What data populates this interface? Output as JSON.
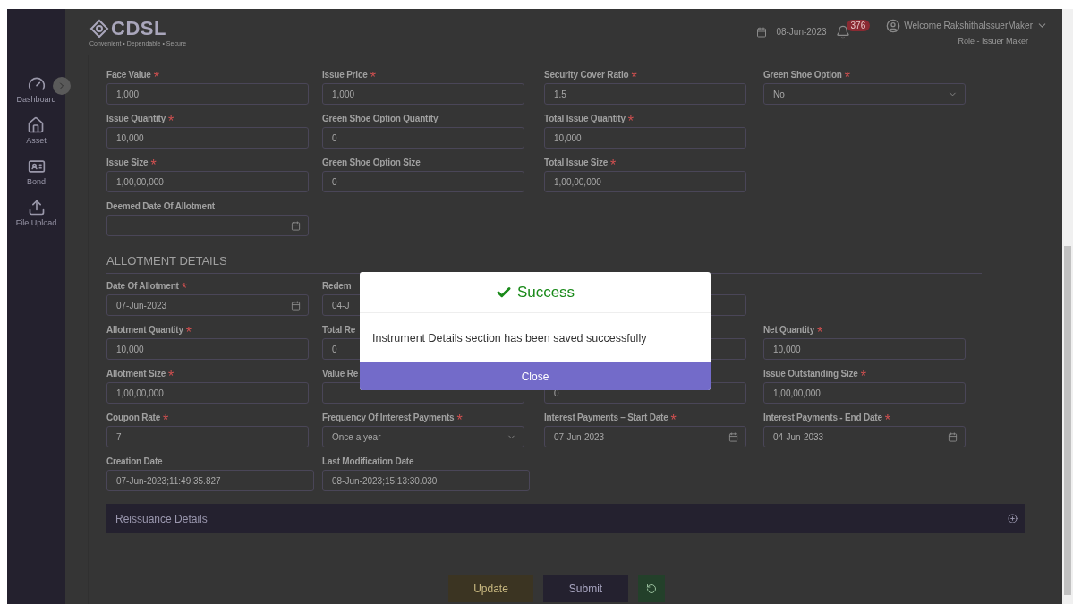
{
  "header": {
    "logo": {
      "name": "CDSL",
      "tagline": "Convenient • Dependable • Secure"
    },
    "date": "08-Jun-2023",
    "notifications": "376",
    "user": {
      "welcome": "Welcome RakshithaIssuerMaker",
      "role": "Role - Issuer Maker"
    }
  },
  "sidebar": {
    "items": [
      {
        "label": "Dashboard"
      },
      {
        "label": "Asset"
      },
      {
        "label": "Bond"
      },
      {
        "label": "File Upload"
      }
    ]
  },
  "issue_fields": [
    {
      "label": "Face Value",
      "marker": "*",
      "value": "1,000",
      "kind": "text"
    },
    {
      "label": "Issue Price",
      "marker": "*",
      "value": "1,000",
      "kind": "text"
    },
    {
      "label": "Security Cover Ratio",
      "marker": "*",
      "value": "1.5",
      "kind": "text"
    },
    {
      "label": "Green Shoe Option",
      "marker": "*",
      "value": "No",
      "kind": "select"
    },
    {
      "label": "Issue Quantity",
      "marker": "*",
      "value": "10,000",
      "kind": "text"
    },
    {
      "label": "Green Shoe Option Quantity",
      "value": "0",
      "kind": "text"
    },
    {
      "label": "Total Issue Quantity",
      "marker": "*",
      "value": "10,000",
      "kind": "text"
    },
    {
      "kind": "empty"
    },
    {
      "label": "Issue Size",
      "marker": "*",
      "value": "1,00,00,000",
      "kind": "text"
    },
    {
      "label": "Green Shoe Option Size",
      "value": "0",
      "kind": "text"
    },
    {
      "label": "Total Issue Size",
      "marker": "*",
      "value": "1,00,00,000",
      "kind": "text"
    },
    {
      "kind": "empty"
    },
    {
      "label": "Deemed Date Of Allotment",
      "kind": "date"
    }
  ],
  "allotment": {
    "title": "ALLOTMENT DETAILS",
    "fields": [
      {
        "label": "Date Of Allotment",
        "marker": "*",
        "value": "07-Jun-2023",
        "kind": "date"
      },
      {
        "label": "Redem",
        "value": "04-J",
        "kind": "text"
      },
      {
        "kind": "text"
      },
      {
        "kind": "empty"
      },
      {
        "label": "Allotment Quantity",
        "marker": "*",
        "value": "10,000",
        "kind": "text"
      },
      {
        "label": "Total Re",
        "value": "0",
        "kind": "text"
      },
      {
        "kind": "text"
      },
      {
        "label": "Net Quantity",
        "marker": "*",
        "value": "10,000",
        "kind": "text"
      },
      {
        "label": "Allotment Size",
        "marker": "*",
        "value": "1,00,00,000",
        "kind": "text"
      },
      {
        "label": "Value Re",
        "kind": "text"
      },
      {
        "value": "0",
        "kind": "text"
      },
      {
        "label": "Issue Outstanding Size",
        "marker": "*",
        "value": "1,00,00,000",
        "kind": "text"
      },
      {
        "label": "Coupon Rate",
        "marker": "*",
        "value": "7",
        "kind": "text"
      },
      {
        "label": "Frequency Of Interest Payments",
        "marker": "*",
        "value": "Once a year",
        "kind": "select"
      },
      {
        "label": "Interest Payments – Start Date",
        "marker": "*",
        "value": "07-Jun-2023",
        "kind": "date"
      },
      {
        "label": "Interest Payments - End Date",
        "marker": "*",
        "value": "04-Jun-2033",
        "kind": "date"
      },
      {
        "label": "Creation Date",
        "value": "07-Jun-2023;11:49:35.827",
        "kind": "text"
      },
      {
        "label": "Last Modification Date",
        "value": "08-Jun-2023;15:13:30.030",
        "kind": "text"
      }
    ]
  },
  "reissuance": {
    "title": "Reissuance Details",
    "expanded": false
  },
  "buttons": [
    {
      "label": "Update",
      "kind": "update"
    },
    {
      "label": "Submit",
      "kind": "submit"
    },
    {
      "kind": "reset"
    }
  ],
  "modal": {
    "title": "Success",
    "message": "Instrument Details section has been saved successfully",
    "button": "Close"
  }
}
